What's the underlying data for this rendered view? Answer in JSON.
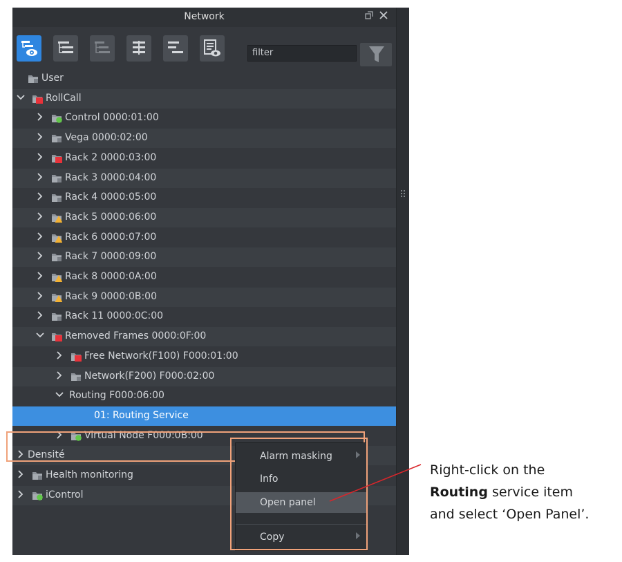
{
  "panel": {
    "title": "Network",
    "title_icons": [
      "restore-icon",
      "close-icon"
    ]
  },
  "toolbar": {
    "buttons": [
      "view-tree-icon",
      "expand-tree-icon",
      "collapse-tree-icon",
      "align-tree-icon",
      "list-tree-icon",
      "details-view-icon"
    ],
    "filter_placeholder": "filter"
  },
  "tree": [
    {
      "label": "User",
      "icon": "folder-gray",
      "level": 1
    },
    {
      "label": "RollCall",
      "icon": "folder-red",
      "level": 0,
      "expanded": true
    },
    {
      "label": "Control 0000:01:00",
      "icon": "folder-green",
      "level": 1
    },
    {
      "label": "Vega 0000:02:00",
      "icon": "folder-gray",
      "level": 1
    },
    {
      "label": "Rack 2 0000:03:00",
      "icon": "folder-red",
      "level": 1
    },
    {
      "label": "Rack 3 0000:04:00",
      "icon": "folder-gray",
      "level": 1
    },
    {
      "label": "Rack 4 0000:05:00",
      "icon": "folder-gray",
      "level": 1
    },
    {
      "label": "Rack 5 0000:06:00",
      "icon": "folder-warning",
      "level": 1
    },
    {
      "label": "Rack 6 0000:07:00",
      "icon": "folder-warning",
      "level": 1
    },
    {
      "label": "Rack 7 0000:09:00",
      "icon": "folder-gray",
      "level": 1
    },
    {
      "label": "Rack 8 0000:0A:00",
      "icon": "folder-warning",
      "level": 1
    },
    {
      "label": "Rack 9 0000:0B:00",
      "icon": "folder-warning",
      "level": 1
    },
    {
      "label": "Rack 11 0000:0C:00",
      "icon": "folder-gray",
      "level": 1
    },
    {
      "label": "Removed Frames 0000:0F:00",
      "icon": "folder-red",
      "level": 1,
      "expanded": true
    },
    {
      "label": "Free Network(F100) F000:01:00",
      "icon": "folder-red",
      "level": 2
    },
    {
      "label": "Network(F200) F000:02:00",
      "icon": "folder-gray",
      "level": 2
    },
    {
      "label": "Routing F000:06:00",
      "icon": "none",
      "level": 2,
      "expanded": true
    },
    {
      "label": "01: Routing Service",
      "icon": "none",
      "level": 3,
      "selected": true
    },
    {
      "label": "Virtual Node F000:0B:00",
      "icon": "folder-green",
      "level": 2
    },
    {
      "label": "Densité",
      "icon": "none",
      "level": 0
    },
    {
      "label": "Health monitoring",
      "icon": "folder-gray",
      "level": 0
    },
    {
      "label": "iControl",
      "icon": "folder-green",
      "level": 0
    }
  ],
  "context_menu": {
    "items": [
      {
        "label": "Alarm masking",
        "submenu": true
      },
      {
        "label": "Info",
        "submenu": false
      },
      {
        "label": "Open panel",
        "submenu": false,
        "highlighted": true
      },
      {
        "label": "Copy",
        "submenu": true
      }
    ]
  },
  "annotation": {
    "line1": "Right-click on the",
    "line2_bold": "Routing",
    "line2_rest": " service item",
    "line3": "and select ‘Open Panel’."
  },
  "colors": {
    "panel_bg": "#35383d",
    "selection": "#3d8fe0",
    "callout": "#f0a27a",
    "leader_line": "#d9262b"
  }
}
